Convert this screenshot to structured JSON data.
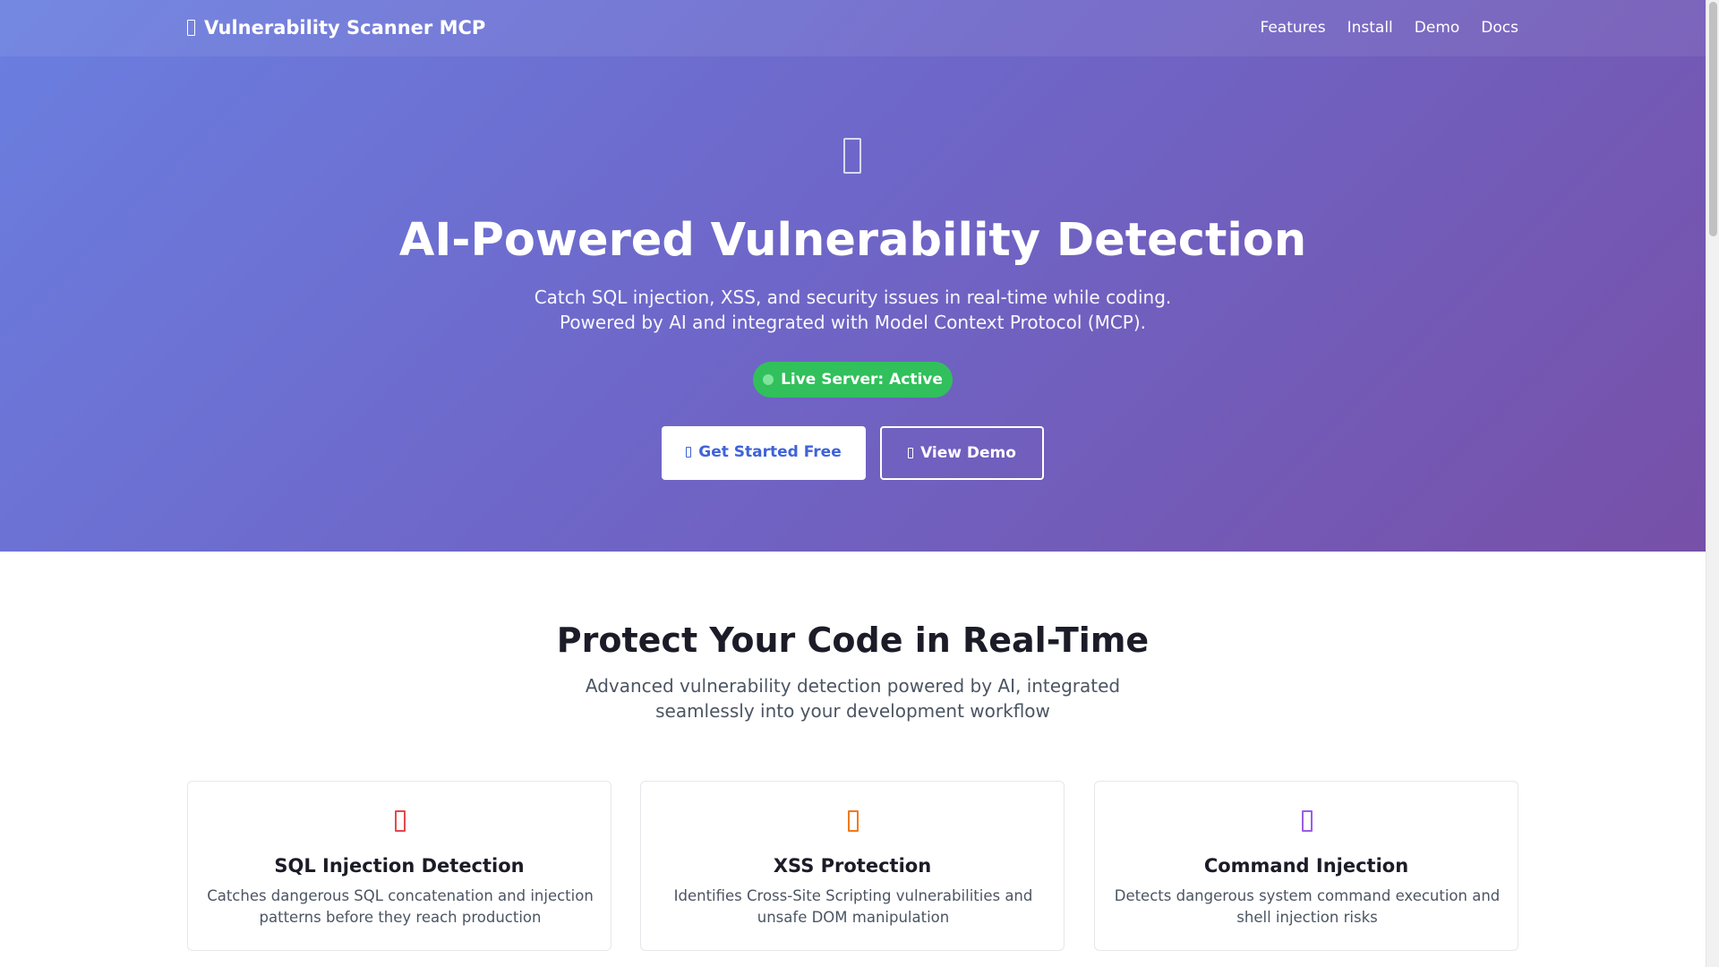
{
  "navbar": {
    "brand": "Vulnerability Scanner MCP",
    "links": [
      "Features",
      "Install",
      "Demo",
      "Docs"
    ]
  },
  "hero": {
    "icon": "shield-icon",
    "title": "AI-Powered Vulnerability Detection",
    "subtitle_line1": "Catch SQL injection, XSS, and security issues in real-time while coding.",
    "subtitle_line2": "Powered by AI and integrated with Model Context Protocol (MCP).",
    "status": "Live Server: Active",
    "primary_button": "Get Started Free",
    "secondary_button": "View Demo"
  },
  "features": {
    "title": "Protect Your Code in Real-Time",
    "subtitle_line1": "Advanced vulnerability detection powered by AI, integrated",
    "subtitle_line2": "seamlessly into your development workflow",
    "cards": [
      {
        "icon": "database-icon",
        "title": "SQL Injection Detection",
        "desc_line1": "Catches dangerous SQL concatenation and injection",
        "desc_line2": "patterns before they reach production",
        "color": "#e5484d"
      },
      {
        "icon": "code-icon",
        "title": "XSS Protection",
        "desc_line1": "Identifies Cross-Site Scripting vulnerabilities and",
        "desc_line2": "unsafe DOM manipulation",
        "color": "#f07a1e"
      },
      {
        "icon": "terminal-icon",
        "title": "Command Injection",
        "desc_line1": "Detects dangerous system command execution and",
        "desc_line2": "shell injection risks",
        "color": "#9b5de5"
      }
    ]
  },
  "colors": {
    "gradient_start": "#6a7fe0",
    "gradient_end": "#7750a8",
    "status_green": "#31c05b",
    "primary_text_blue": "#3f63d8"
  }
}
